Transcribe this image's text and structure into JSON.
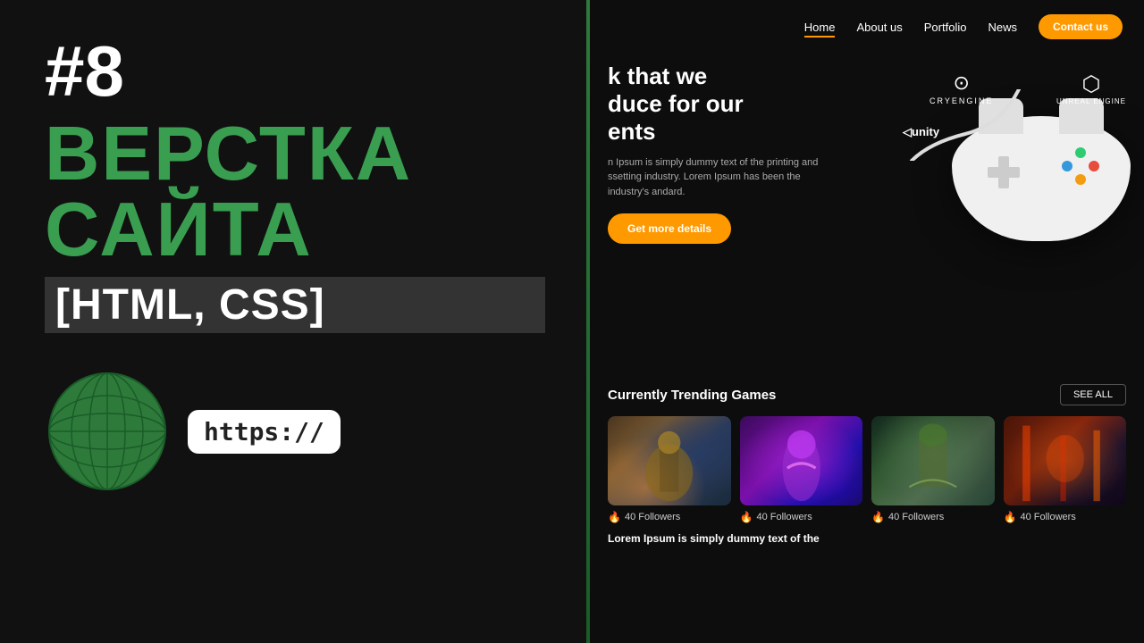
{
  "left": {
    "episode": "#8",
    "title_line1": "ВЕРСТКА",
    "title_line2": "САЙТА",
    "subtitle": "[HTML, CSS]",
    "https_label": "https://"
  },
  "nav": {
    "links": [
      {
        "label": "Home",
        "active": true
      },
      {
        "label": "About us",
        "active": false
      },
      {
        "label": "Portfolio",
        "active": false
      },
      {
        "label": "News",
        "active": false
      }
    ],
    "contact_btn": "Contact us"
  },
  "hero": {
    "heading_line1": "k that we",
    "heading_line2": "duce for our",
    "heading_line3": "ents",
    "body_text": "n Ipsum is simply dummy text of the printing and ssetting industry. Lorem Ipsum has been the industry's andard.",
    "cta_btn": "Get more details",
    "logos": {
      "cryengine": "CRYENGINE",
      "unreal": "UNREAL ENGINE",
      "unity": "◁unity"
    }
  },
  "trending": {
    "section_title": "Currently Trending Games",
    "see_all_label": "SEE ALL",
    "games": [
      {
        "followers": "40 Followers"
      },
      {
        "followers": "40 Followers"
      },
      {
        "followers": "40 Followers"
      },
      {
        "followers": "40 Followers"
      }
    ]
  },
  "footer_text": "Lorem Ipsum is simply dummy text of the"
}
